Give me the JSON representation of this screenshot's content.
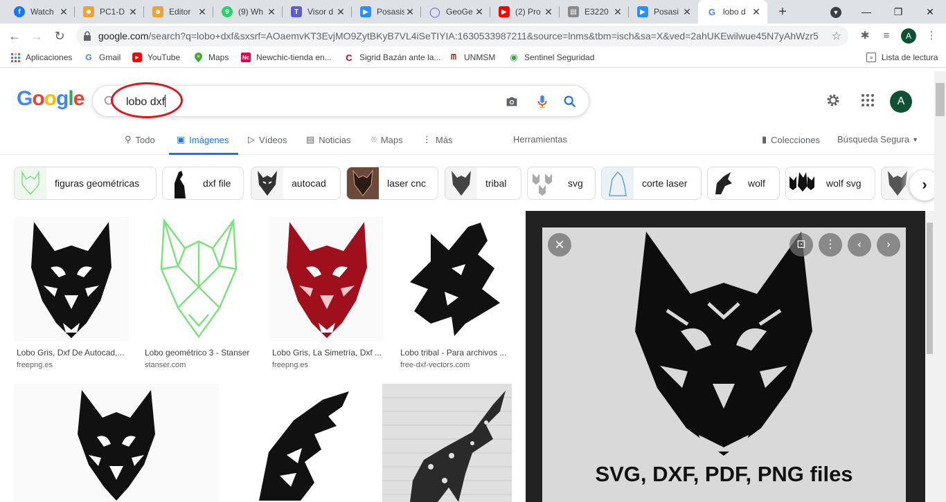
{
  "tabs": [
    {
      "title": "Watch",
      "icon": "facebook-icon",
      "color": "#1877f2",
      "glyph": "f"
    },
    {
      "title": "PC1-D",
      "icon": "meeting-icon",
      "color": "#e8a33d",
      "glyph": "•"
    },
    {
      "title": "Editor",
      "icon": "meeting-icon",
      "color": "#e8a33d",
      "glyph": "•"
    },
    {
      "title": "(9) Wh",
      "icon": "whatsapp-icon",
      "color": "#25d366",
      "glyph": "9"
    },
    {
      "title": "Visor d",
      "icon": "teams-icon",
      "color": "#5b5fc7",
      "glyph": "T"
    },
    {
      "title": "Posasis",
      "icon": "zoom-icon",
      "color": "#2d8cff",
      "glyph": "▶"
    },
    {
      "title": "GeoGe",
      "icon": "geogebra-icon",
      "color": "#6557d2",
      "glyph": "◯"
    },
    {
      "title": "(2) Pro",
      "icon": "youtube-icon",
      "color": "#ff0000",
      "glyph": "▶"
    },
    {
      "title": "E3220",
      "icon": "document-icon",
      "color": "#888888",
      "glyph": "▤"
    },
    {
      "title": "Posasi",
      "icon": "zoom-icon",
      "color": "#2d8cff",
      "glyph": "▶"
    },
    {
      "title": "lobo d",
      "icon": "google-icon",
      "color": "#4285f4",
      "glyph": "G"
    }
  ],
  "omnibox": {
    "url_host": "google.com",
    "url_rest": "/search?q=lobo+dxf&sxsrf=AOaemvKT3EvjMO9ZytBKyB7VL4iSeTIYIA:1630533987211&source=lnms&tbm=isch&sa=X&ved=2ahUKEwilwue45N7yAhWzr5..."
  },
  "profile_initial": "A",
  "bookmarks": [
    {
      "label": "Aplicaciones",
      "icon": "apps-grid-icon"
    },
    {
      "label": "Gmail",
      "icon": "google-icon"
    },
    {
      "label": "YouTube",
      "icon": "youtube-icon"
    },
    {
      "label": "Maps",
      "icon": "maps-pin-icon"
    },
    {
      "label": "Newchic-tienda en...",
      "icon": "newchic-icon"
    },
    {
      "label": "Sigrid Bazán ante la...",
      "icon": "news-icon"
    },
    {
      "label": "UNMSM",
      "icon": "unmsm-icon"
    },
    {
      "label": "Sentinel Seguridad",
      "icon": "eye-icon"
    }
  ],
  "reading_list": "Lista de lectura",
  "search": {
    "query": "lobo dxf"
  },
  "google_tabs": [
    {
      "label": "Todo",
      "icon": "search-icon"
    },
    {
      "label": "Imágenes",
      "icon": "image-icon"
    },
    {
      "label": "Vídeos",
      "icon": "play-icon"
    },
    {
      "label": "Noticias",
      "icon": "news-icon"
    },
    {
      "label": "Maps",
      "icon": "maps-pin-icon"
    },
    {
      "label": "Más",
      "icon": "more-vert-icon"
    }
  ],
  "tools_label": "Herramientas",
  "collections_label": "Colecciones",
  "safe_search_label": "Búsqueda Segura",
  "chips": [
    {
      "label": "figuras geométricas"
    },
    {
      "label": "dxf file"
    },
    {
      "label": "autocad"
    },
    {
      "label": "laser cnc"
    },
    {
      "label": "tribal"
    },
    {
      "label": "svg"
    },
    {
      "label": "corte laser"
    },
    {
      "label": "wolf"
    },
    {
      "label": "wolf svg"
    }
  ],
  "results": [
    {
      "title": "Lobo Gris, Dxf De Autocad,...",
      "source": "freepng.es"
    },
    {
      "title": "Lobo geométrico 3 - Stanser",
      "source": "stanser.com"
    },
    {
      "title": "Lobo Gris, La Simetría, Dxf ...",
      "source": "freepng.es"
    },
    {
      "title": "Lobo tribal - Para archivos ...",
      "source": "free-dxf-vectors.com"
    }
  ],
  "preview": {
    "caption": "SVG, DXF, PDF, PNG files"
  },
  "colors": {
    "accent": "#1a73e8",
    "annotation": "#e0141e"
  }
}
